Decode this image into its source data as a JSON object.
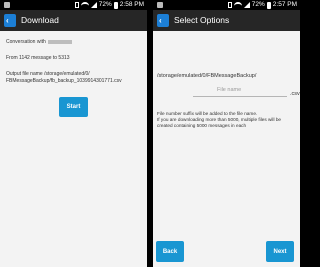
{
  "left_screen": {
    "status": {
      "time": "2:58 PM",
      "battery": "72%"
    },
    "title": "Download",
    "conversation_label": "Conversation with",
    "range_text": "From 1142 message to 5313",
    "output_line1": "Output file name /storage/emulated/0/",
    "output_line2": "FBMessageBackup/fb_backup_1039914301771.csv",
    "start_label": "Start"
  },
  "right_screen": {
    "status": {
      "time": "2:57 PM",
      "battery": "72%"
    },
    "title": "Select Options",
    "path": "/storage/emulated/0/FBMessageBackup/",
    "filename_placeholder": "File name",
    "suffix": ".csv",
    "info_line1": "File number suffix will be added to the file name.",
    "info_line2": "If you are downloading more than 5000, multiple files will be",
    "info_line3": "created containing 5000 messages in each",
    "back_label": "Back",
    "next_label": "Next"
  }
}
